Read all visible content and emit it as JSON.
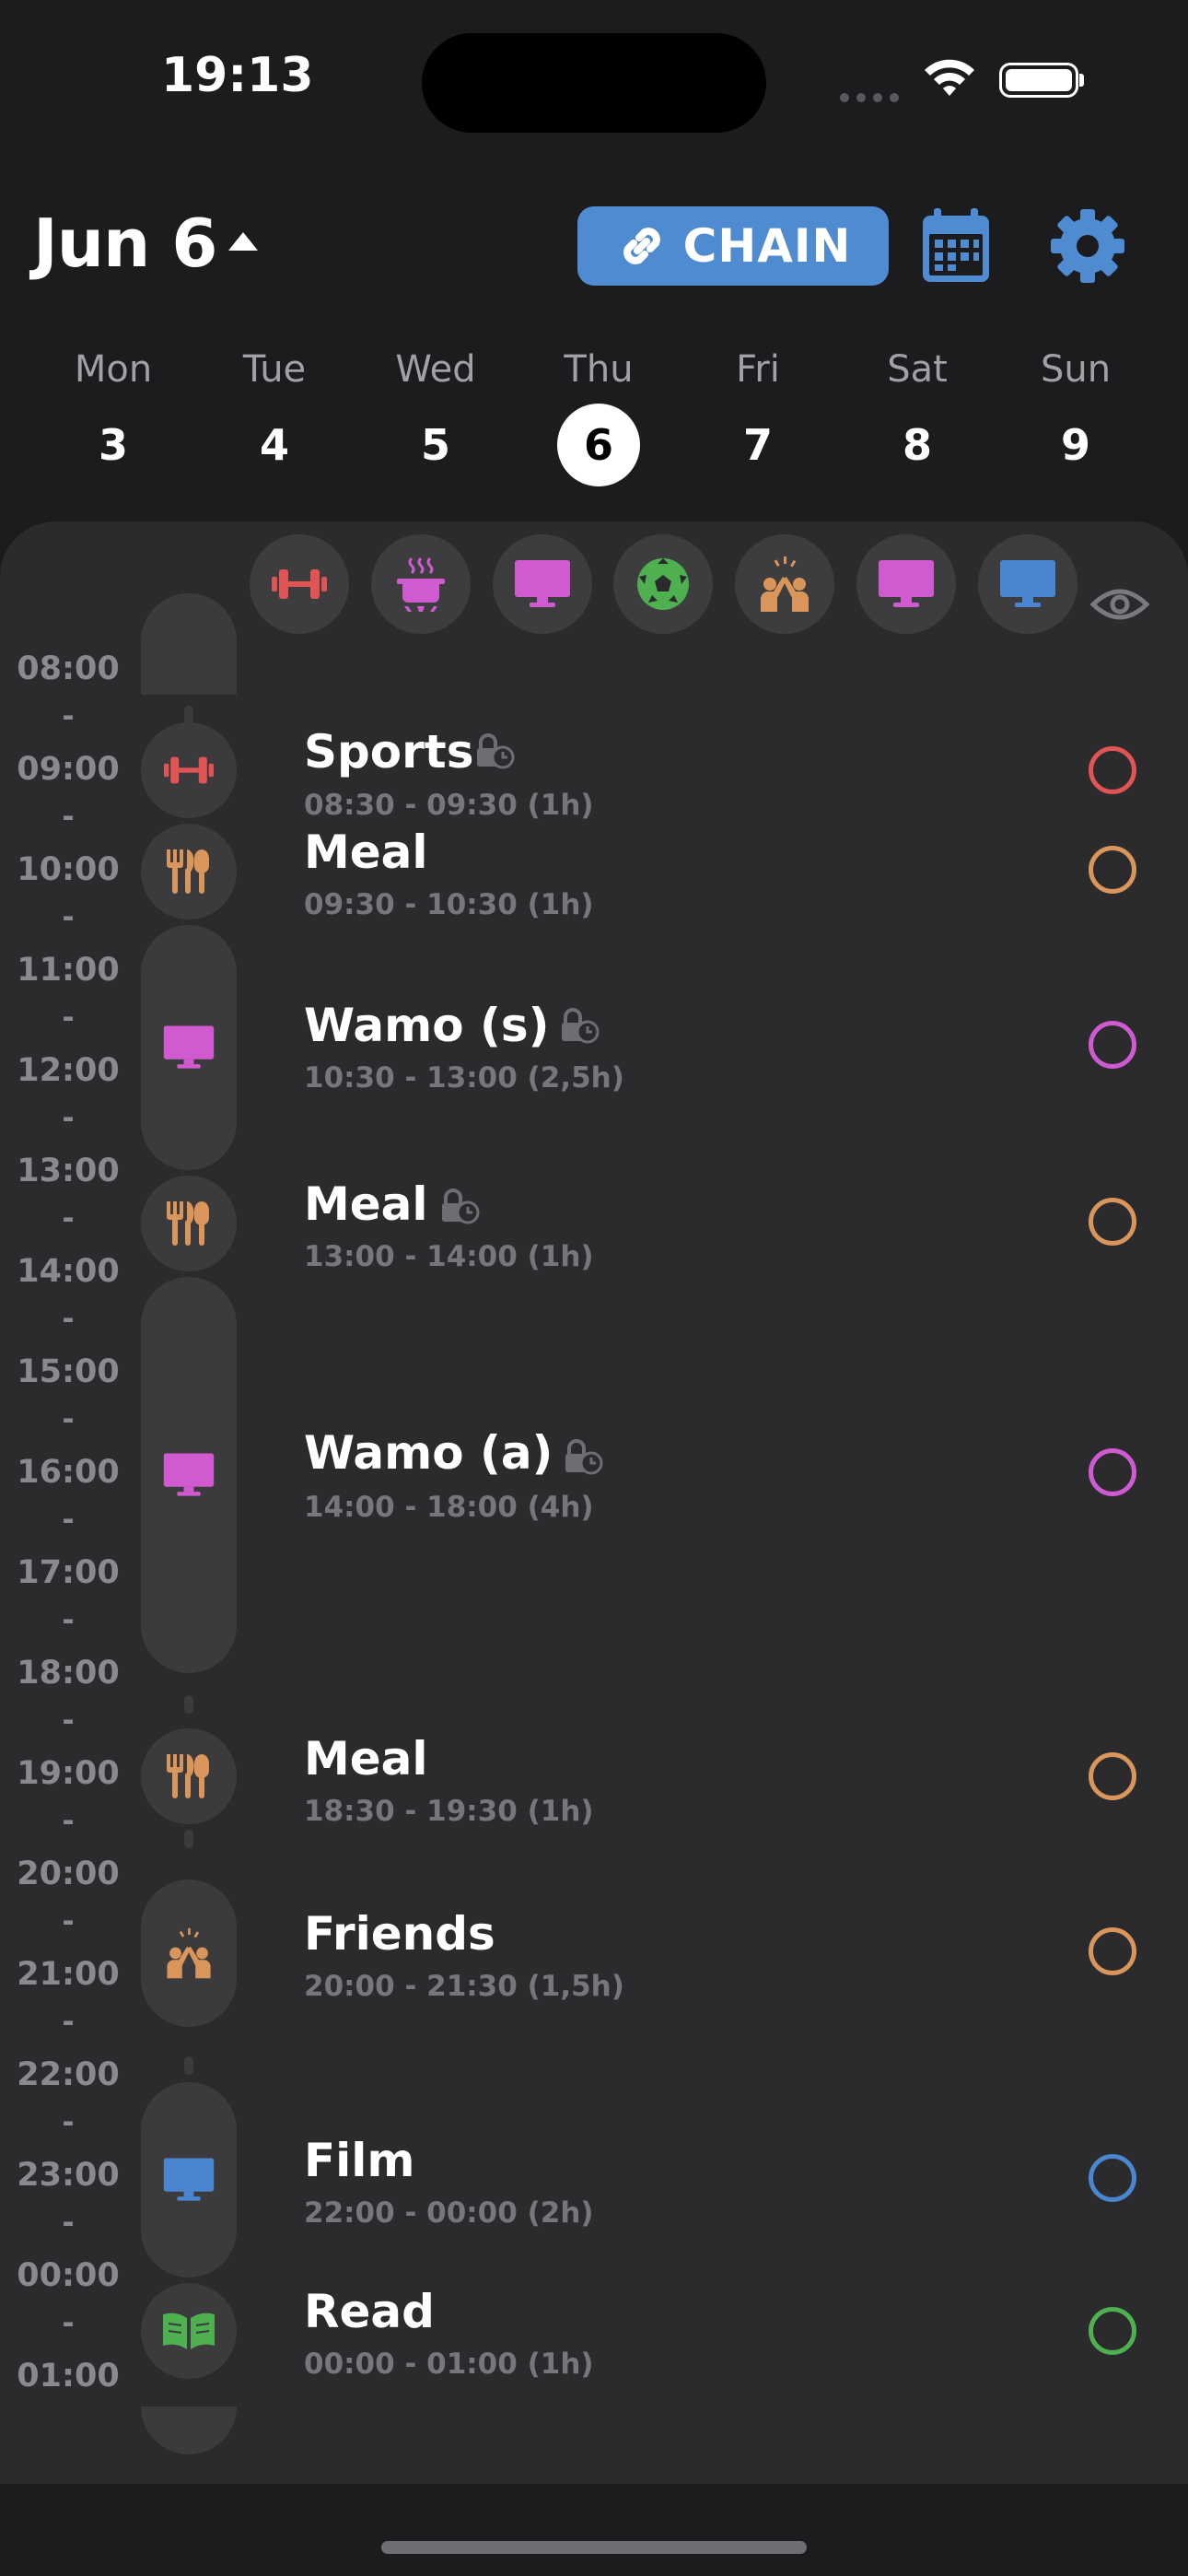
{
  "status_bar": {
    "time": "19:13"
  },
  "header": {
    "date_label": "Jun 6",
    "chain_label": "CHAIN"
  },
  "week": [
    {
      "name": "Mon",
      "num": "3"
    },
    {
      "name": "Tue",
      "num": "4"
    },
    {
      "name": "Wed",
      "num": "5"
    },
    {
      "name": "Thu",
      "num": "6",
      "selected": true
    },
    {
      "name": "Fri",
      "num": "7"
    },
    {
      "name": "Sat",
      "num": "8"
    },
    {
      "name": "Sun",
      "num": "9"
    }
  ],
  "category_filters": [
    {
      "icon": "dumbbell-icon",
      "color": "#e05454"
    },
    {
      "icon": "cooking-pot-icon",
      "color": "#d05ad0"
    },
    {
      "icon": "monitor-icon",
      "color": "#d05ad0"
    },
    {
      "icon": "soccer-ball-icon",
      "color": "#4fb04f"
    },
    {
      "icon": "high-five-icon",
      "color": "#d9955a"
    },
    {
      "icon": "monitor-icon",
      "color": "#d05ad0"
    },
    {
      "icon": "monitor-icon",
      "color": "#4a86d0"
    }
  ],
  "hours": [
    "08:00",
    "09:00",
    "10:00",
    "11:00",
    "12:00",
    "13:00",
    "14:00",
    "15:00",
    "16:00",
    "17:00",
    "18:00",
    "19:00",
    "20:00",
    "21:00",
    "22:00",
    "23:00",
    "00:00",
    "01:00"
  ],
  "events": [
    {
      "title": "Sports",
      "time": "08:30 - 09:30 (1h)",
      "icon": "dumbbell-icon",
      "color": "#e05454",
      "locked": true
    },
    {
      "title": "Meal",
      "time": "09:30 - 10:30 (1h)",
      "icon": "cutlery-icon",
      "color": "#d9955a",
      "locked": false
    },
    {
      "title": "Wamo (s)",
      "time": "10:30 - 13:00 (2,5h)",
      "icon": "monitor-icon",
      "color": "#d05ad0",
      "locked": true
    },
    {
      "title": "Meal",
      "time": "13:00 - 14:00 (1h)",
      "icon": "cutlery-icon",
      "color": "#d9955a",
      "locked": true
    },
    {
      "title": "Wamo (a)",
      "time": "14:00 - 18:00 (4h)",
      "icon": "monitor-icon",
      "color": "#d05ad0",
      "locked": true
    },
    {
      "title": "Meal",
      "time": "18:30 - 19:30 (1h)",
      "icon": "cutlery-icon",
      "color": "#d9955a",
      "locked": false
    },
    {
      "title": "Friends",
      "time": "20:00 - 21:30 (1,5h)",
      "icon": "high-five-icon",
      "color": "#d9955a",
      "locked": false
    },
    {
      "title": "Film",
      "time": "22:00 - 00:00 (2h)",
      "icon": "monitor-icon",
      "color": "#4a86d0",
      "locked": false
    },
    {
      "title": "Read",
      "time": "00:00 - 01:00 (1h)",
      "icon": "book-icon",
      "color": "#4fb04f",
      "locked": false
    }
  ]
}
